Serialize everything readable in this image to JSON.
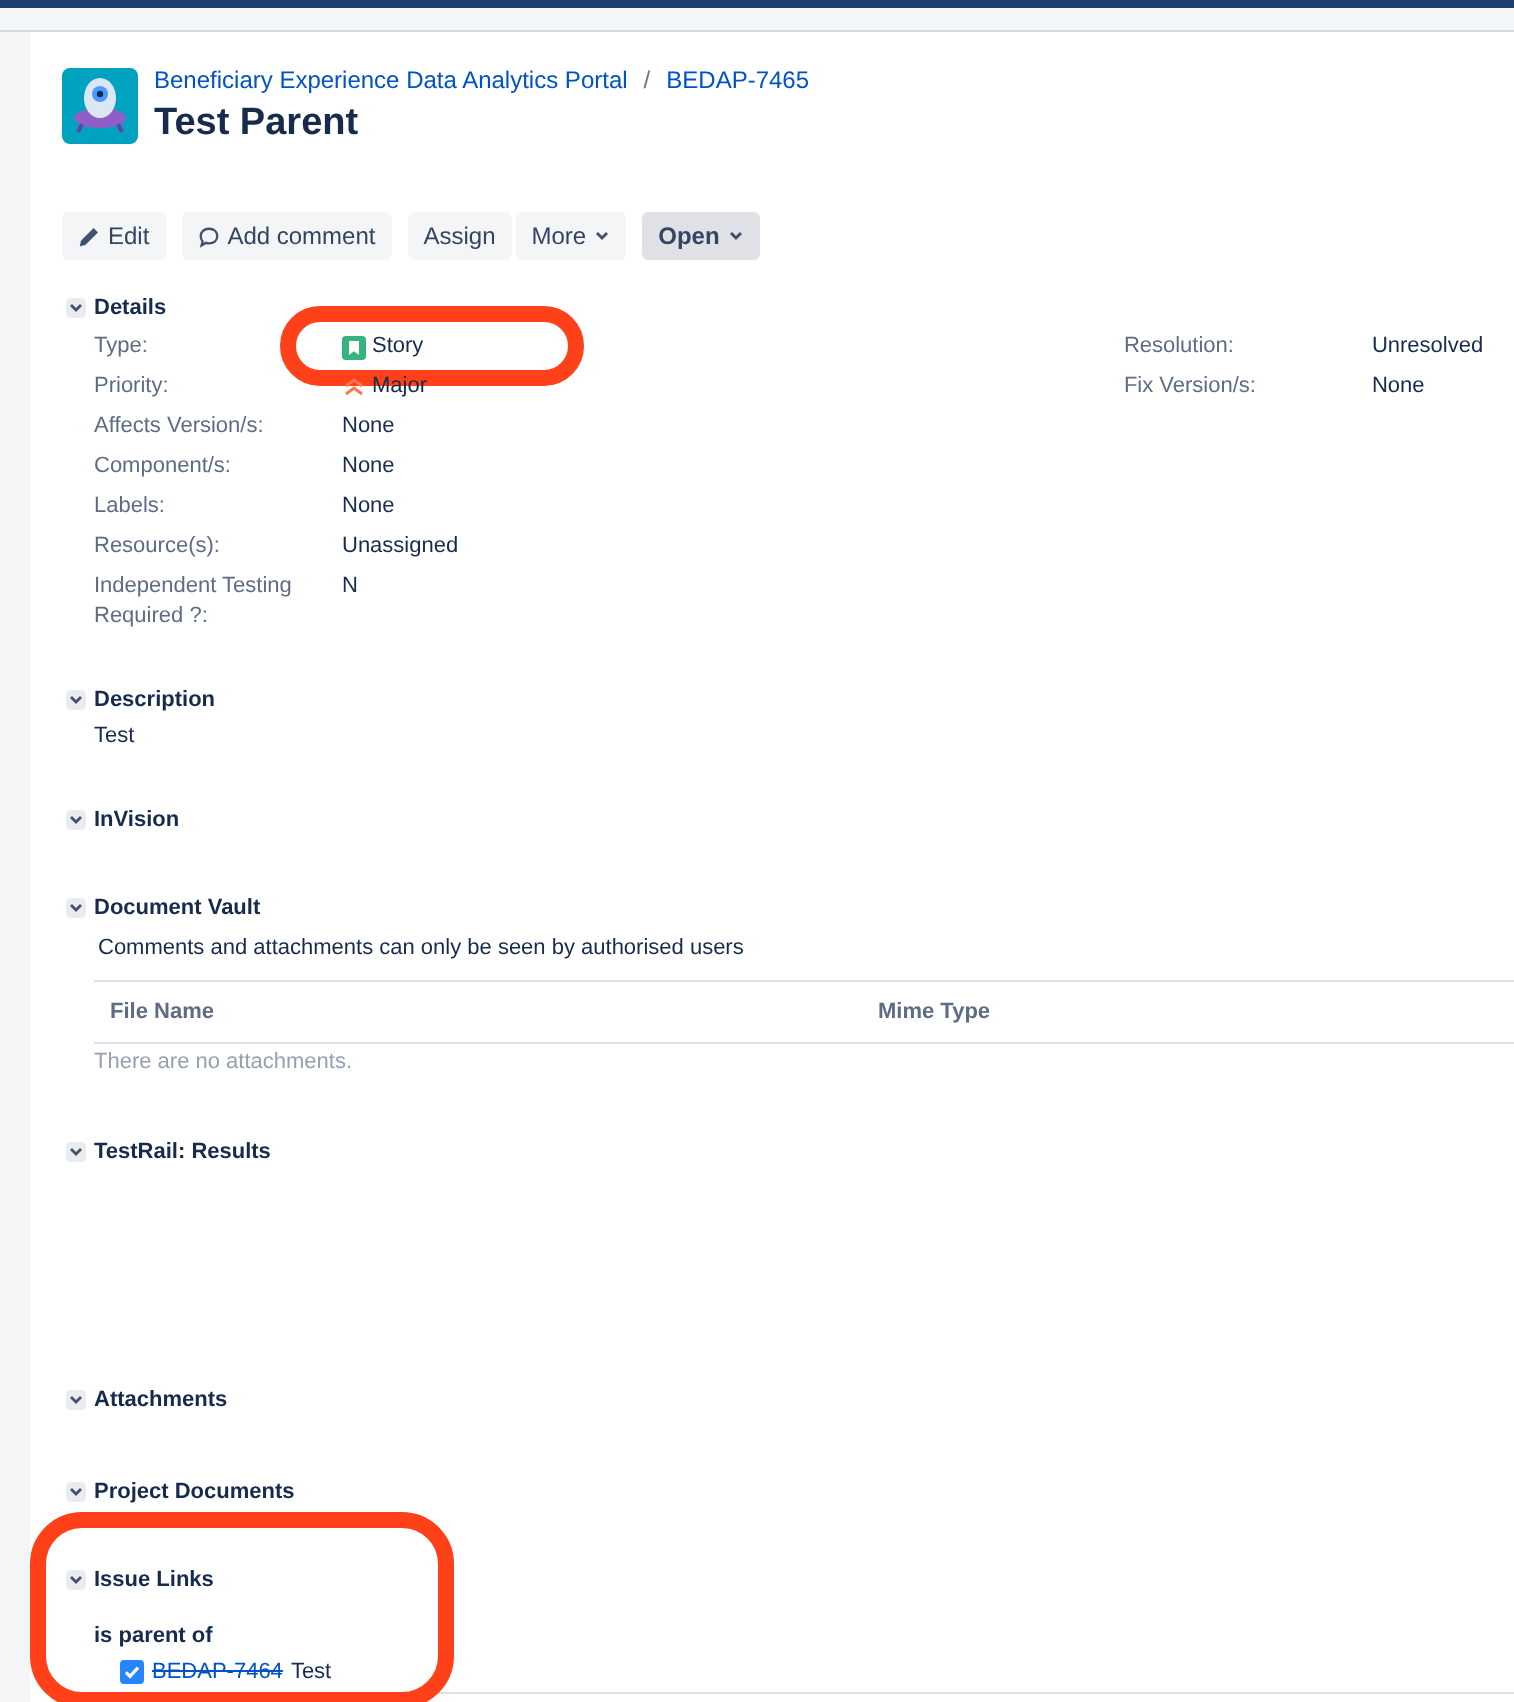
{
  "breadcrumb": {
    "project": "Beneficiary Experience Data Analytics Portal",
    "separator": "/",
    "issue_key": "BEDAP-7465"
  },
  "title": "Test Parent",
  "toolbar": [
    {
      "label": "Edit",
      "kind": "edit"
    },
    {
      "label": "Add comment",
      "kind": "comment"
    },
    {
      "label": "Assign",
      "kind": "plain"
    },
    {
      "label": "More",
      "kind": "dropdown"
    },
    {
      "label": "Open",
      "kind": "status"
    }
  ],
  "sections": [
    {
      "title": "Details",
      "kind": "fields",
      "expanded": true,
      "left": [
        {
          "label": "Type:",
          "value": "Story",
          "kind": "issue-type",
          "highlighted": true
        },
        {
          "label": "Priority:",
          "value": "Major",
          "kind": "priority"
        },
        {
          "label": "Affects Version/s:",
          "value": "None",
          "kind": "text"
        },
        {
          "label": "Component/s:",
          "value": "None",
          "kind": "text"
        },
        {
          "label": "Labels:",
          "value": "None",
          "kind": "text"
        },
        {
          "label": "Resource(s):",
          "value": "Unassigned",
          "kind": "text"
        },
        {
          "label": "Independent Testing Required ?:",
          "value": "N",
          "kind": "text"
        }
      ],
      "right": [
        {
          "label": "Resolution:",
          "value": "Unresolved",
          "kind": "text"
        },
        {
          "label": "Fix Version/s:",
          "value": "None",
          "kind": "text"
        }
      ]
    },
    {
      "title": "Description",
      "kind": "text",
      "expanded": true,
      "text": "Test"
    },
    {
      "title": "InVision",
      "kind": "empty",
      "expanded": true
    },
    {
      "title": "Document Vault",
      "kind": "vault",
      "expanded": true,
      "note": "Comments and attachments can only be seen by authorised users",
      "columns": [
        "File Name",
        "Mime Type"
      ],
      "empty_message": "There are no attachments."
    },
    {
      "title": "TestRail: Results",
      "kind": "results",
      "expanded": true
    },
    {
      "title": "Attachments",
      "kind": "empty",
      "expanded": true
    },
    {
      "title": "Project Documents",
      "kind": "empty",
      "expanded": true
    },
    {
      "title": "Issue Links",
      "kind": "links",
      "expanded": true,
      "highlighted": true,
      "relation": "is parent of",
      "links": [
        {
          "key": "BEDAP-7464",
          "summary": "Test",
          "resolved": true
        }
      ]
    }
  ]
}
